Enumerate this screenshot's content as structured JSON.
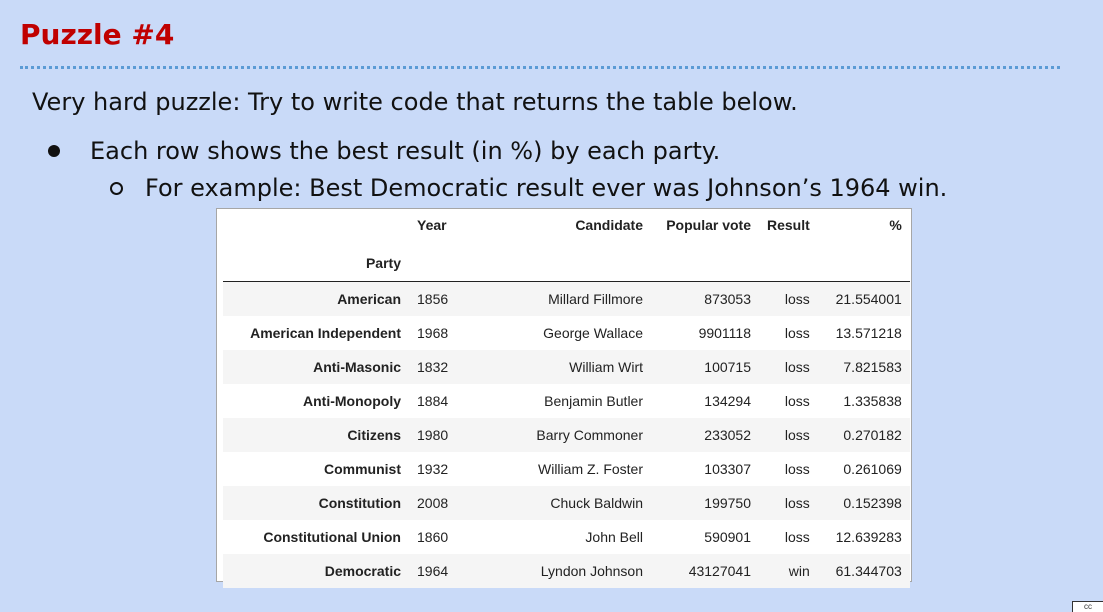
{
  "slide": {
    "title": "Puzzle #4",
    "intro": "Very hard puzzle: Try to write code that returns the table below.",
    "bullet1": "Each row shows the best result (in %) by each party.",
    "bullet2": "For example: Best Democratic result ever was Johnson’s 1964 win."
  },
  "table": {
    "columns": {
      "year": "Year",
      "candidate": "Candidate",
      "popular_vote": "Popular vote",
      "result": "Result",
      "pct": "%"
    },
    "index_name": "Party",
    "rows": [
      {
        "party": "American",
        "year": "1856",
        "candidate": "Millard Fillmore",
        "popular_vote": "873053",
        "result": "loss",
        "pct": "21.554001"
      },
      {
        "party": "American Independent",
        "year": "1968",
        "candidate": "George Wallace",
        "popular_vote": "9901118",
        "result": "loss",
        "pct": "13.571218"
      },
      {
        "party": "Anti-Masonic",
        "year": "1832",
        "candidate": "William Wirt",
        "popular_vote": "100715",
        "result": "loss",
        "pct": "7.821583"
      },
      {
        "party": "Anti-Monopoly",
        "year": "1884",
        "candidate": "Benjamin Butler",
        "popular_vote": "134294",
        "result": "loss",
        "pct": "1.335838"
      },
      {
        "party": "Citizens",
        "year": "1980",
        "candidate": "Barry Commoner",
        "popular_vote": "233052",
        "result": "loss",
        "pct": "0.270182"
      },
      {
        "party": "Communist",
        "year": "1932",
        "candidate": "William Z. Foster",
        "popular_vote": "103307",
        "result": "loss",
        "pct": "0.261069"
      },
      {
        "party": "Constitution",
        "year": "2008",
        "candidate": "Chuck Baldwin",
        "popular_vote": "199750",
        "result": "loss",
        "pct": "0.152398"
      },
      {
        "party": "Constitutional Union",
        "year": "1860",
        "candidate": "John Bell",
        "popular_vote": "590901",
        "result": "loss",
        "pct": "12.639283"
      },
      {
        "party": "Democratic",
        "year": "1964",
        "candidate": "Lyndon Johnson",
        "popular_vote": "43127041",
        "result": "win",
        "pct": "61.344703"
      }
    ]
  },
  "colors": {
    "background": "#c9daf8",
    "title": "#c00000",
    "divider": "#5b9bd5"
  },
  "icons": {
    "license_badge": "creative-commons-icon"
  }
}
